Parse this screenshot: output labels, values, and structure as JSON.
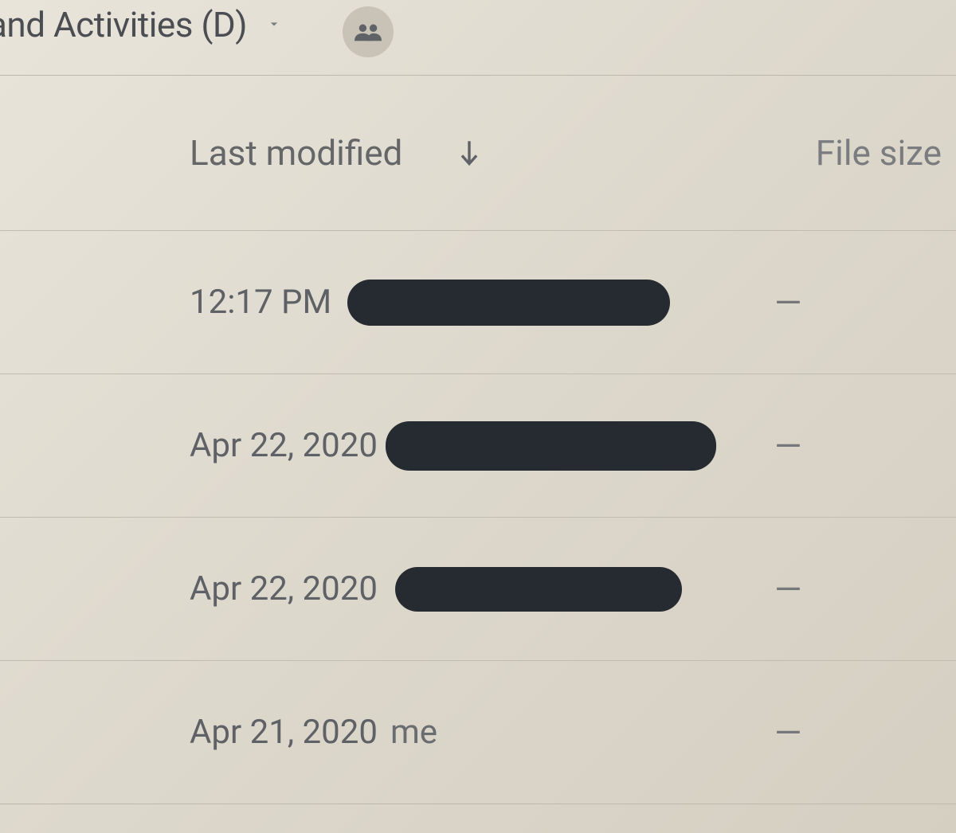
{
  "breadcrumb": {
    "title": "and Activities (D)"
  },
  "columns": {
    "last_modified": "Last modified",
    "file_size": "File size"
  },
  "rows": [
    {
      "modified": "12:17 PM",
      "modifier": "",
      "redacted": true,
      "size": "—"
    },
    {
      "modified": "Apr 22, 2020",
      "modifier": "",
      "redacted": true,
      "size": "—"
    },
    {
      "modified": "Apr 22, 2020",
      "modifier": "",
      "redacted": true,
      "size": "—"
    },
    {
      "modified": "Apr 21, 2020",
      "modifier": "me",
      "redacted": false,
      "size": "—"
    }
  ]
}
